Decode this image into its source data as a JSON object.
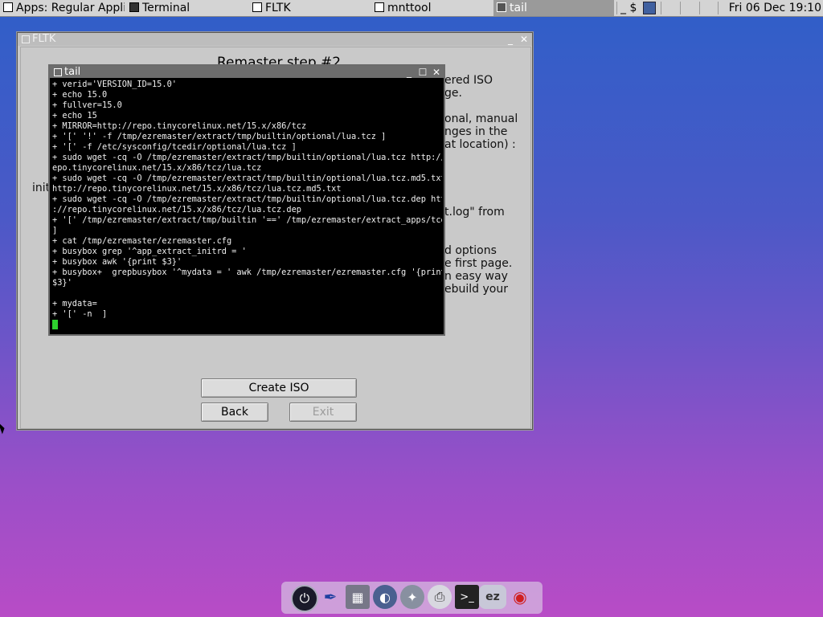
{
  "taskbar": {
    "tasks": [
      {
        "label": "Apps: Regular Applic",
        "active": false
      },
      {
        "label": "Terminal",
        "active": false
      },
      {
        "label": "FLTK",
        "active": false
      },
      {
        "label": "mnttool",
        "active": false
      },
      {
        "label": "tail",
        "active": true
      }
    ],
    "tray_text": "_ $",
    "clock": "Fri 06 Dec 19:10"
  },
  "fltk_window": {
    "title": "FLTK",
    "step_title": "Remaster step #2",
    "fragments": [
      "ered ISO",
      "ge.",
      "onal, manual",
      "nges in the",
      "at location) :",
      "initr",
      "t.log\" from",
      "d options",
      "e first page.",
      "n easy way",
      "ebuild your"
    ],
    "buttons": {
      "create_iso": "Create ISO",
      "back": "Back",
      "exit": "Exit"
    }
  },
  "terminal": {
    "title": "tail",
    "lines": [
      "+ verid='VERSION_ID=15.0'",
      "+ echo 15.0",
      "+ fullver=15.0",
      "+ echo 15",
      "+ MIRROR=http://repo.tinycorelinux.net/15.x/x86/tcz",
      "+ '[' '!' -f /tmp/ezremaster/extract/tmp/builtin/optional/lua.tcz ]",
      "+ '[' -f /etc/sysconfig/tcedir/optional/lua.tcz ]",
      "+ sudo wget -cq -O /tmp/ezremaster/extract/tmp/builtin/optional/lua.tcz http://r",
      "epo.tinycorelinux.net/15.x/x86/tcz/lua.tcz",
      "+ sudo wget -cq -O /tmp/ezremaster/extract/tmp/builtin/optional/lua.tcz.md5.txt",
      "http://repo.tinycorelinux.net/15.x/x86/tcz/lua.tcz.md5.txt",
      "+ sudo wget -cq -O /tmp/ezremaster/extract/tmp/builtin/optional/lua.tcz.dep http",
      "://repo.tinycorelinux.net/15.x/x86/tcz/lua.tcz.dep",
      "+ '[' /tmp/ezremaster/extract/tmp/builtin '==' /tmp/ezremaster/extract_apps/tce",
      "]",
      "+ cat /tmp/ezremaster/ezremaster.cfg",
      "+ busybox grep '^app_extract_initrd = '",
      "+ busybox awk '{print $3}'",
      "+ busybox+  grepbusybox '^mydata = ' awk /tmp/ezremaster/ezremaster.cfg '{print",
      "$3}'",
      "",
      "+ mydata=",
      "+ '[' -n  ]"
    ]
  },
  "dock": {
    "icons": [
      "power-icon",
      "pen-icon",
      "image-icon",
      "apps-icon",
      "run-icon",
      "printer-icon",
      "terminal-icon",
      "ezremaster-icon",
      "wifi-icon"
    ],
    "ezremaster_label": "ez"
  }
}
